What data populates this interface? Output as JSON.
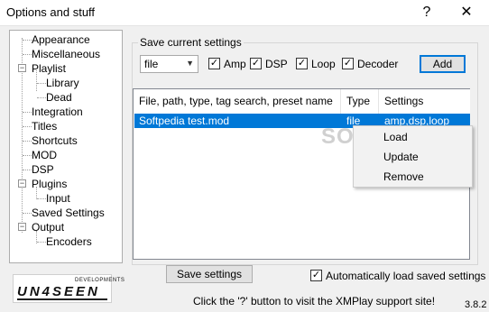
{
  "window": {
    "title": "Options and stuff",
    "help_label": "?",
    "close_label": "✕"
  },
  "tree": {
    "items": [
      {
        "label": "Appearance"
      },
      {
        "label": "Miscellaneous"
      },
      {
        "label": "Playlist",
        "expander": "−"
      },
      {
        "label": "Library"
      },
      {
        "label": "Dead"
      },
      {
        "label": "Integration"
      },
      {
        "label": "Titles"
      },
      {
        "label": "Shortcuts"
      },
      {
        "label": "MOD"
      },
      {
        "label": "DSP"
      },
      {
        "label": "Plugins",
        "expander": "−"
      },
      {
        "label": "Input"
      },
      {
        "label": "Saved Settings"
      },
      {
        "label": "Output",
        "expander": "−"
      },
      {
        "label": "Encoders"
      }
    ]
  },
  "save_group": {
    "label": "Save current settings",
    "type_select": {
      "value": "file",
      "arrow": "▼"
    },
    "checkboxes": [
      {
        "label": "Amp",
        "checked": true,
        "mark": "✓"
      },
      {
        "label": "DSP",
        "checked": true,
        "mark": "✓"
      },
      {
        "label": "Loop",
        "checked": true,
        "mark": "✓"
      },
      {
        "label": "Decoder",
        "checked": true,
        "mark": "✓"
      }
    ],
    "add_label": "Add"
  },
  "list": {
    "columns": [
      "File, path, type, tag search, preset name",
      "Type",
      "Settings"
    ],
    "rows": [
      {
        "name": "Softpedia test.mod",
        "type": "file",
        "settings": "amp,dsp,loop"
      }
    ]
  },
  "watermark": "SOFTPEDIA",
  "context_menu": {
    "items": [
      "Load",
      "Update",
      "Remove"
    ]
  },
  "footer": {
    "save_button": "Save settings",
    "auto_load": {
      "label": "Automatically load saved settings",
      "checked": true,
      "mark": "✓"
    },
    "hint": "Click the '?' button to visit the XMPlay support site!",
    "version": "3.8.2",
    "logo_text": "UN4SEEN",
    "logo_sub": "DEVELOPMENTS"
  }
}
